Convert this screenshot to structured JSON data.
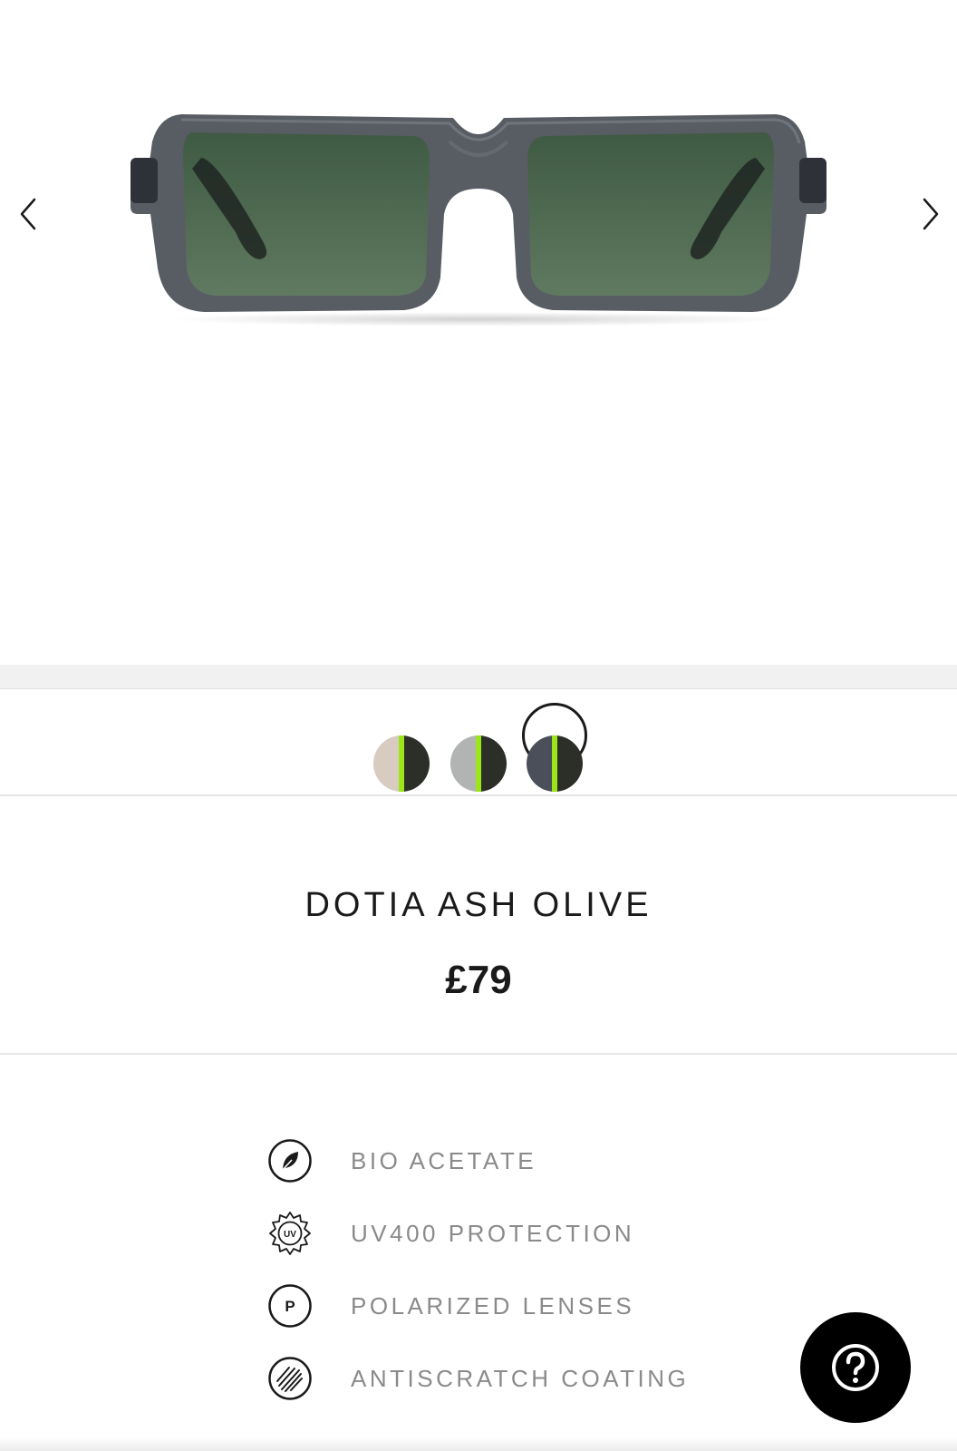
{
  "gallery": {
    "prev_icon": "chevron-left-icon",
    "next_icon": "chevron-right-icon",
    "frame_color": "#4a4f57",
    "lens_color": "#4f6b50"
  },
  "swatches": [
    {
      "name": "sand",
      "left_color": "#d8cbbf",
      "right_color": "#2c2e28",
      "accent": "#9be619",
      "selected": false
    },
    {
      "name": "grey",
      "left_color": "#b2b4b4",
      "right_color": "#2c2e28",
      "accent": "#9be619",
      "selected": false
    },
    {
      "name": "ash",
      "left_color": "#4a4f5a",
      "right_color": "#2c2e28",
      "accent": "#9be619",
      "selected": true
    }
  ],
  "product": {
    "name": "DOTIA ASH OLIVE",
    "price": "£79"
  },
  "features": [
    {
      "icon": "leaf-icon",
      "label": "BIO ACETATE"
    },
    {
      "icon": "uv-badge-icon",
      "label": "UV400 PROTECTION"
    },
    {
      "icon": "polarized-icon",
      "label": "POLARIZED LENSES"
    },
    {
      "icon": "antiscratch-icon",
      "label": "ANTISCRATCH COATING"
    }
  ],
  "help": {
    "icon": "question-mark-icon"
  }
}
